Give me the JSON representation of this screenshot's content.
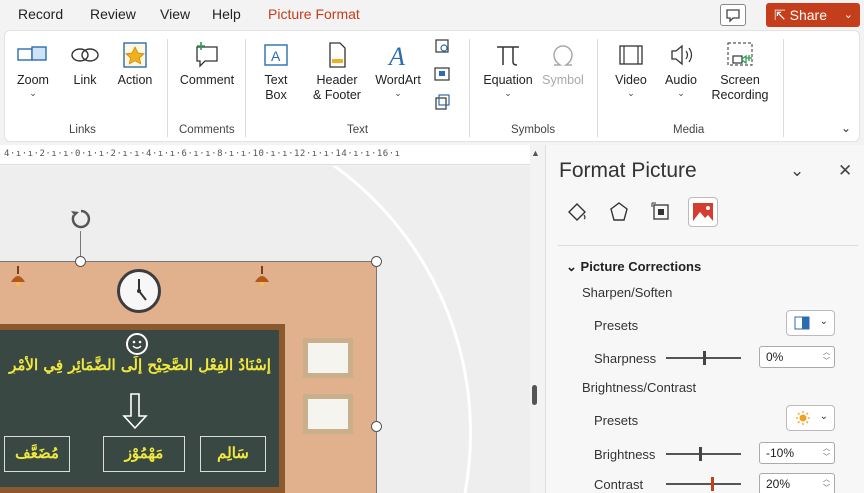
{
  "tabs": [
    {
      "label": "Record"
    },
    {
      "label": "Review"
    },
    {
      "label": "View"
    },
    {
      "label": "Help"
    },
    {
      "label": "Picture Format"
    }
  ],
  "share_label": "Share",
  "ribbon": {
    "links": {
      "zoom": "Zoom",
      "link": "Link",
      "action": "Action",
      "group": "Links"
    },
    "comments": {
      "comment": "Comment",
      "group": "Comments"
    },
    "text": {
      "textbox_1": "Text",
      "textbox_2": "Box",
      "header_1": "Header",
      "header_2": "& Footer",
      "wordart": "WordArt",
      "group": "Text"
    },
    "symbols": {
      "equation": "Equation",
      "symbol": "Symbol",
      "group": "Symbols"
    },
    "media": {
      "video": "Video",
      "audio": "Audio",
      "screen_1": "Screen",
      "screen_2": "Recording",
      "group": "Media"
    }
  },
  "ruler_text": "4·ı·ı·2·ı·ı·0·ı·ı·2·ı·ı·4·ı·ı·6·ı·ı·8·ı·ı·10·ı·ı·12·ı·ı·14·ı·ı·16·ı",
  "slide": {
    "title": "إِسْنَادُ الفِعْلِ الصَّحِيْحِ إِلَى الضَّمَائِرِ فِي الأَمْرِ",
    "words": [
      "مُضَعَّف",
      "مَهْمُوْز",
      "سَالِم"
    ]
  },
  "pane": {
    "title": "Format Picture",
    "section": "Picture Corrections",
    "sharpen_heading": "Sharpen/Soften",
    "presets_label": "Presets",
    "sharpness_label": "Sharpness",
    "sharpness_value": "0%",
    "brightness_heading": "Brightness/Contrast",
    "brightness_label": "Brightness",
    "brightness_value": "-10%",
    "contrast_label": "Contrast",
    "contrast_value": "20%"
  },
  "colors": {
    "accent": "#c43e1c",
    "board": "#3a4843",
    "text_yellow": "#f0e93d"
  }
}
